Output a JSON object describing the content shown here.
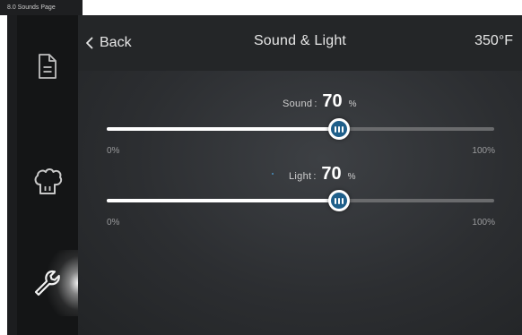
{
  "page_label": "8.0 Sounds Page",
  "header": {
    "back_label": "Back",
    "title": "Sound & Light",
    "temperature": "350°F"
  },
  "sidebar": {
    "items": [
      {
        "icon": "document-icon",
        "active": false
      },
      {
        "icon": "chef-hat-icon",
        "active": false
      },
      {
        "icon": "wrench-icon",
        "active": true
      }
    ]
  },
  "sound": {
    "label": "Sound",
    "separator": ":",
    "value": "70",
    "unit": "%",
    "level": 0.6,
    "min_label": "0%",
    "max_label": "100%"
  },
  "light": {
    "label": "Light",
    "separator": ":",
    "value": "70",
    "unit": "%",
    "level": 0.6,
    "min_label": "0%",
    "max_label": "100%"
  },
  "colors": {
    "thumb": "#1f5f8a",
    "track_fill": "#ffffff",
    "track_empty": "#6a6b6d",
    "background": "#2c2e31"
  }
}
